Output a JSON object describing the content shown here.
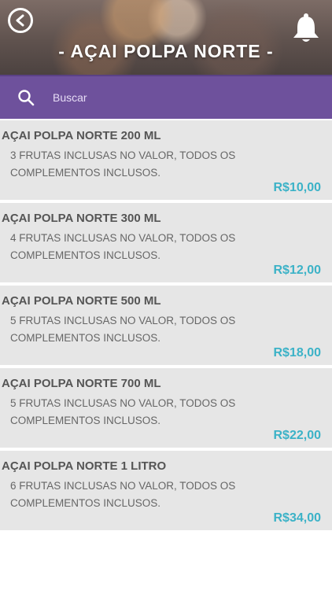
{
  "header": {
    "title": "- AÇAI POLPA NORTE -",
    "back_icon": "chevron-left-circle-icon",
    "bell_icon": "bell-icon"
  },
  "search": {
    "placeholder": "Buscar",
    "value": "",
    "icon": "search-icon",
    "bar_color": "#6e519c"
  },
  "colors": {
    "price": "#3bb2c7",
    "item_bg": "#e6e6e6"
  },
  "products": [
    {
      "name": "AÇAI POLPA NORTE 200 ML",
      "description": "3 FRUTAS INCLUSAS NO VALOR, TODOS OS COMPLEMENTOS INCLUSOS.",
      "price": "R$10,00"
    },
    {
      "name": "AÇAI POLPA NORTE 300 ML",
      "description": "4 FRUTAS INCLUSAS NO VALOR, TODOS OS COMPLEMENTOS INCLUSOS.",
      "price": "R$12,00"
    },
    {
      "name": "AÇAI POLPA NORTE 500 ML",
      "description": "5 FRUTAS INCLUSAS NO VALOR, TODOS OS COMPLEMENTOS INCLUSOS.",
      "price": "R$18,00"
    },
    {
      "name": "AÇAI POLPA NORTE 700 ML",
      "description": "5 FRUTAS INCLUSAS NO VALOR, TODOS OS COMPLEMENTOS INCLUSOS.",
      "price": "R$22,00"
    },
    {
      "name": "AÇAI POLPA NORTE 1 LITRO",
      "description": "6 FRUTAS INCLUSAS NO VALOR, TODOS OS COMPLEMENTOS INCLUSOS.",
      "price": "R$34,00"
    }
  ]
}
